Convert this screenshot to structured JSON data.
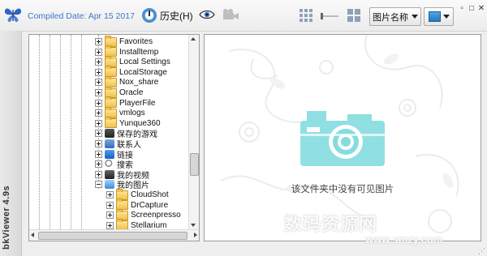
{
  "app": {
    "compiled_date": "Compiled Date: Apr 15 2017",
    "vertical_title": "bkViewer 4.9s"
  },
  "toolbar": {
    "history_label": "历史(H)",
    "sort_label": "图片名称",
    "accent_color": "#3a78c8"
  },
  "window_controls": {
    "restore": "▫",
    "maximize": "□",
    "close": "✕"
  },
  "tree": {
    "items": [
      {
        "label": "Favorites",
        "icon": "folder-icon",
        "expander": "plus"
      },
      {
        "label": "Installtemp",
        "icon": "folder-icon",
        "expander": "plus"
      },
      {
        "label": "Local Settings",
        "icon": "folder-icon",
        "expander": "plus"
      },
      {
        "label": "LocalStorage",
        "icon": "folder-icon",
        "expander": "plus"
      },
      {
        "label": "Nox_share",
        "icon": "folder-icon",
        "expander": "plus"
      },
      {
        "label": "Oracle",
        "icon": "folder-icon",
        "expander": "plus"
      },
      {
        "label": "PlayerFile",
        "icon": "folder-icon",
        "expander": "plus"
      },
      {
        "label": "vmlogs",
        "icon": "folder-icon",
        "expander": "plus"
      },
      {
        "label": "Yunque360",
        "icon": "folder-icon",
        "expander": "plus"
      },
      {
        "label": "保存的游戏",
        "icon": "saved-games-icon",
        "expander": "plus"
      },
      {
        "label": "联系人",
        "icon": "contacts-icon",
        "expander": "plus"
      },
      {
        "label": "链接",
        "icon": "links-icon",
        "expander": "plus"
      },
      {
        "label": "搜索",
        "icon": "search-icon",
        "expander": "plus"
      },
      {
        "label": "我的视频",
        "icon": "videos-icon",
        "expander": "plus"
      },
      {
        "label": "我的图片",
        "icon": "pictures-icon",
        "expander": "minus"
      }
    ],
    "children": [
      {
        "label": "CloudShot",
        "icon": "folder-icon",
        "expander": "plus"
      },
      {
        "label": "DrCapture",
        "icon": "folder-icon",
        "expander": "plus"
      },
      {
        "label": "Screenpresso",
        "icon": "folder-icon",
        "expander": "plus"
      },
      {
        "label": "Stellarium",
        "icon": "folder-icon",
        "expander": "plus"
      }
    ]
  },
  "viewer": {
    "empty_message": "该文件夹中没有可见图片",
    "camera_color": "#7fd8dc"
  },
  "watermark": {
    "main": "数码资源网",
    "sub": "www.smzy.com"
  }
}
